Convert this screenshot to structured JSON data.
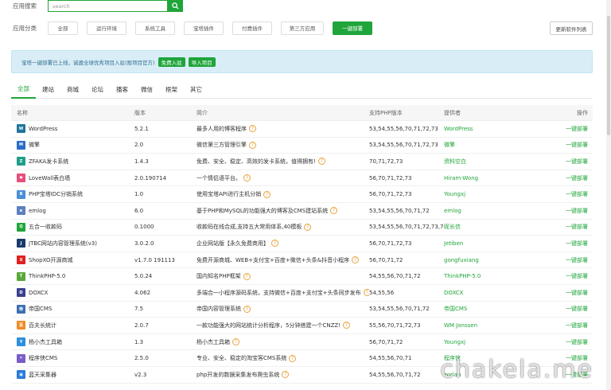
{
  "search": {
    "label": "应用搜索",
    "placeholder": "search"
  },
  "category": {
    "label": "应用分类",
    "buttons": [
      "全部",
      "运行环境",
      "系统工具",
      "宝塔插件",
      "付费插件",
      "第三方应用",
      "一键部署"
    ],
    "active_index": 6,
    "update_label": "更新软件列表"
  },
  "notice": {
    "text": "宝塔一键部署已上线，诚邀全球优秀项目入驻(限项目官方)",
    "btn_join": "免费入驻",
    "btn_import": "导入项目"
  },
  "tabs": [
    "全部",
    "建站",
    "商城",
    "论坛",
    "播客",
    "微信",
    "框架",
    "其它"
  ],
  "table": {
    "headers": [
      "名称",
      "版本",
      "简介",
      "支持PHP版本",
      "提供者",
      "操作"
    ],
    "rows": [
      {
        "name": "WordPress",
        "version": "5.2.1",
        "desc": "最多人用的博客程序",
        "php": "53,54,55,56,70,71,72,73",
        "provider": "WordPress",
        "action": "一键部署",
        "icon": "wordpress-icon",
        "color": "#21759b",
        "glyph": "W"
      },
      {
        "name": "微擎",
        "version": "2.0",
        "desc": "微信第三方管理引擎",
        "php": "53,54,55,56,70,71,72,73",
        "provider": "微擎",
        "action": "一键部署",
        "icon": "weiqing-icon",
        "color": "#2a6cc7",
        "glyph": "M"
      },
      {
        "name": "ZFAKA发卡系统",
        "version": "1.4.3",
        "desc": "免费、安全、稳定、高效的发卡系统，值得拥有!",
        "php": "70,71,72,73",
        "provider": "资料空白",
        "action": "一键部署",
        "icon": "zfaka-icon",
        "color": "#1e9e8a",
        "glyph": "Z"
      },
      {
        "name": "LoveWall表白墙",
        "version": "2.0.190714",
        "desc": "一个情侣语平台。",
        "php": "56,70,71,72,73",
        "provider": "Hiram-Wong",
        "action": "一键部署",
        "icon": "lovewall-icon",
        "color": "#e84e7a",
        "glyph": "♥"
      },
      {
        "name": "PHP宝塔IDC分销系统",
        "version": "1.0",
        "desc": "使用宝塔API进行主机分销",
        "php": "56,70,71,72,73",
        "provider": "Youngxj",
        "action": "一键部署",
        "icon": "idc-icon",
        "color": "#4a8fd8",
        "glyph": "B"
      },
      {
        "name": "emlog",
        "version": "6.0",
        "desc": "基于PHP和MySQL的功能强大的博客及CMS建站系统",
        "php": "53,54,55,56,70,71,72",
        "provider": "emlog",
        "action": "一键部署",
        "icon": "emlog-icon",
        "color": "#5c7fbf",
        "glyph": "e"
      },
      {
        "name": "五合一收款码",
        "version": "0.1000",
        "desc": "收款码在线合成,支持五大常用体系,40模板",
        "php": "53,54,55,56,70,71,72,73,74",
        "provider": "昵长信",
        "action": "一键部署",
        "icon": "qrcode-icon",
        "color": "#20a53a",
        "glyph": "Q"
      },
      {
        "name": "JTBC网站内容管理系统(v3)",
        "version": "3.0.2.0",
        "desc": "企业网站版【永久免费商用】",
        "php": "56,70,71,72,73",
        "provider": "Jetiben",
        "action": "一键部署",
        "icon": "jtbc-icon",
        "color": "#1a3a6b",
        "glyph": "J"
      },
      {
        "name": "ShopXO开源商城",
        "version": "v1.7.0 191113",
        "desc": "免费开源商城、WEB+支付宝+百度+微信+头条&抖音小程序",
        "php": "56,70,71,72",
        "provider": "gongfuxiang",
        "action": "一键部署",
        "icon": "shopxo-icon",
        "color": "#e02020",
        "glyph": "X"
      },
      {
        "name": "ThinkPHP-5.0",
        "version": "5.0.24",
        "desc": "国内知名PHP框架",
        "php": "54,55,56,70,71,72",
        "provider": "ThinkPHP-5.0",
        "action": "一键部署",
        "icon": "thinkphp-icon",
        "color": "#5aa839",
        "glyph": "T"
      },
      {
        "name": "DOXCX",
        "version": "4.062",
        "desc": "多端合一小程序源码系统，支持微信+百度+支付宝+头条同步发布",
        "php": "54,55,56",
        "provider": "DOXCX",
        "action": "一键部署",
        "icon": "doxcx-icon",
        "color": "#3a3f8f",
        "glyph": "D"
      },
      {
        "name": "帝国CMS",
        "version": "7.5",
        "desc": "帝国内容管理系统",
        "php": "53,54,55,56,70,71,72",
        "provider": "帝国CMS",
        "action": "一键部署",
        "icon": "empirecms-icon",
        "color": "#3d6fb5",
        "glyph": "帝"
      },
      {
        "name": "百夫长统计",
        "version": "2.0.7",
        "desc": "一款功能强大的网站统计分析程序，5分钟搭建一个CNZZ!",
        "php": "55,56,70,71,72,73",
        "provider": "WM Jonssen",
        "action": "一键部署",
        "icon": "stats-icon",
        "color": "#f08c2a",
        "glyph": "百"
      },
      {
        "name": "杨小杰工具箱",
        "version": "1.3",
        "desc": "杨小杰工具箱",
        "php": "56,70,71,72",
        "provider": "Youngxj",
        "action": "一键部署",
        "icon": "toolbox-icon",
        "color": "#2c8fe0",
        "glyph": "Y"
      },
      {
        "name": "程序侠CMS",
        "version": "2.5.0",
        "desc": "专业、安全、稳定的淘宝客CMS系统",
        "php": "54,55,56,70,71",
        "provider": "程序侠",
        "action": "一键部署",
        "icon": "chengxuxia-icon",
        "color": "#7a5cc7",
        "glyph": "✕"
      },
      {
        "name": "蓝天采集器",
        "version": "v2.3",
        "desc": "php开发的数据采集发布爬虫系统",
        "php": "54,55,56,70,71,72",
        "provider": "zorlan",
        "action": "一键部署",
        "icon": "skycaiji-icon",
        "color": "#2a7ad8",
        "glyph": "▣"
      }
    ]
  },
  "watermark": "chakela.me"
}
